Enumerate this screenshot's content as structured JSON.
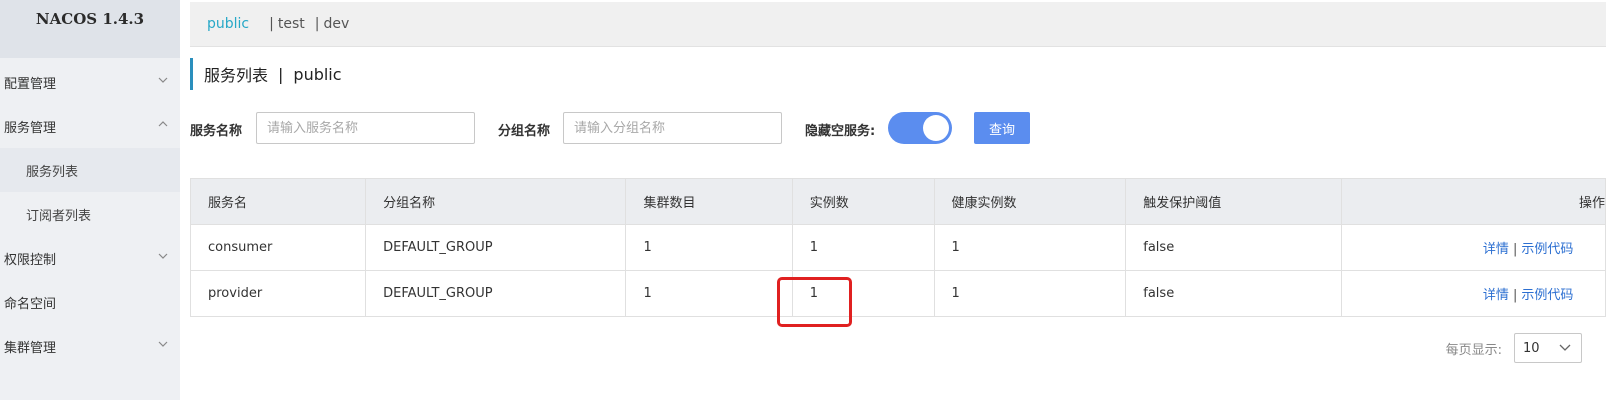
{
  "app": {
    "title": "NACOS 1.4.3"
  },
  "sidebar": {
    "items": [
      {
        "label": "配置管理"
      },
      {
        "label": "服务管理"
      },
      {
        "label": "服务列表"
      },
      {
        "label": "订阅者列表"
      },
      {
        "label": "权限控制"
      },
      {
        "label": "命名空间"
      },
      {
        "label": "集群管理"
      }
    ]
  },
  "namespaces": {
    "active": "public",
    "others": [
      "test",
      "dev"
    ],
    "separator": "|"
  },
  "page": {
    "title": "服务列表",
    "separator": "|",
    "namespace": "public"
  },
  "filters": {
    "service_name_label": "服务名称",
    "service_name_placeholder": "请输入服务名称",
    "group_name_label": "分组名称",
    "group_name_placeholder": "请输入分组名称",
    "hide_empty_label": "隐藏空服务:",
    "hide_empty_on": true,
    "query_label": "查询"
  },
  "table": {
    "headers": [
      "服务名",
      "分组名称",
      "集群数目",
      "实例数",
      "健康实例数",
      "触发保护阈值",
      "操作"
    ],
    "rows": [
      {
        "service": "consumer",
        "group": "DEFAULT_GROUP",
        "clusters": "1",
        "instances": "1",
        "healthy": "1",
        "threshold": "false",
        "detail": "详情",
        "sample": "示例代码"
      },
      {
        "service": "provider",
        "group": "DEFAULT_GROUP",
        "clusters": "1",
        "instances": "1",
        "healthy": "1",
        "threshold": "false",
        "detail": "详情",
        "sample": "示例代码"
      }
    ]
  },
  "pager": {
    "label": "每页显示:",
    "page_size": "10"
  },
  "colors": {
    "accent": "#5b8def",
    "link": "#2c6fd1",
    "namespace_active": "#27a8c7",
    "highlight": "#e02020"
  }
}
